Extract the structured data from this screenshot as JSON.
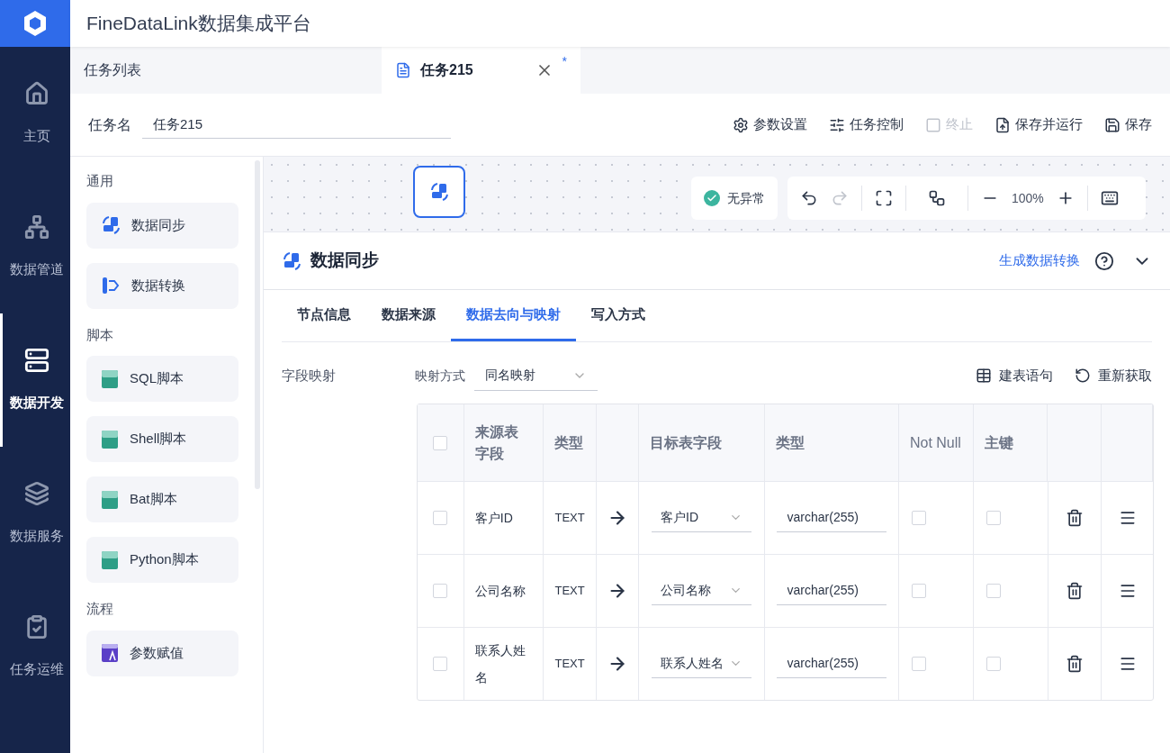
{
  "app": {
    "title": "FineDataLink数据集成平台"
  },
  "nav": [
    {
      "label": "主页",
      "selected": false
    },
    {
      "label": "数据管道",
      "selected": false
    },
    {
      "label": "数据开发",
      "selected": true
    },
    {
      "label": "数据服务",
      "selected": false
    },
    {
      "label": "任务运维",
      "selected": false
    }
  ],
  "tabs": [
    {
      "label": "任务列表",
      "selected": false
    },
    {
      "label": "任务215",
      "selected": true,
      "modified_mark": "*"
    }
  ],
  "task_name": {
    "label": "任务名",
    "value": "任务215"
  },
  "toolbar": [
    {
      "label": "参数设置",
      "disabled": false
    },
    {
      "label": "任务控制",
      "disabled": false
    },
    {
      "label": "终止",
      "disabled": true
    },
    {
      "label": "保存并运行",
      "disabled": false
    },
    {
      "label": "保存",
      "disabled": false
    }
  ],
  "palette": [
    {
      "group": "通用",
      "items": [
        {
          "label": "数据同步"
        },
        {
          "label": "数据转换"
        }
      ]
    },
    {
      "group": "脚本",
      "items": [
        {
          "label": "SQL脚本"
        },
        {
          "label": "Shell脚本"
        },
        {
          "label": "Bat脚本"
        },
        {
          "label": "Python脚本"
        }
      ]
    },
    {
      "group": "流程",
      "items": [
        {
          "label": "参数赋值"
        }
      ]
    }
  ],
  "canvas": {
    "status": "无异常",
    "zoom": "100%",
    "undo_disabled": false,
    "redo_disabled": true
  },
  "panel": {
    "title": "数据同步",
    "link": "生成数据转换",
    "tabs": [
      {
        "label": "节点信息",
        "selected": false
      },
      {
        "label": "数据来源",
        "selected": false
      },
      {
        "label": "数据去向与映射",
        "selected": true
      },
      {
        "label": "写入方式",
        "selected": false
      }
    ],
    "section_label": "字段映射",
    "mapping_label": "映射方式",
    "mapping_value": "同名映射",
    "actions": [
      {
        "label": "建表语句"
      },
      {
        "label": "重新获取"
      }
    ]
  },
  "table": {
    "header_checked": false,
    "columns": [
      "来源表字段",
      "类型",
      "目标表字段",
      "类型",
      "Not Null",
      "主键"
    ],
    "rows": [
      {
        "checked": false,
        "source": "客户ID",
        "type": "TEXT",
        "target": "客户ID",
        "target_type": "varchar(255)",
        "not_null": false,
        "primary_key": false
      },
      {
        "checked": false,
        "source": "公司名称",
        "type": "TEXT",
        "target": "公司名称",
        "target_type": "varchar(255)",
        "not_null": false,
        "primary_key": false
      },
      {
        "checked": false,
        "source": "联系人姓名",
        "type": "TEXT",
        "target": "联系人姓名",
        "target_type": "varchar(255)",
        "not_null": false,
        "primary_key": false
      }
    ]
  }
}
